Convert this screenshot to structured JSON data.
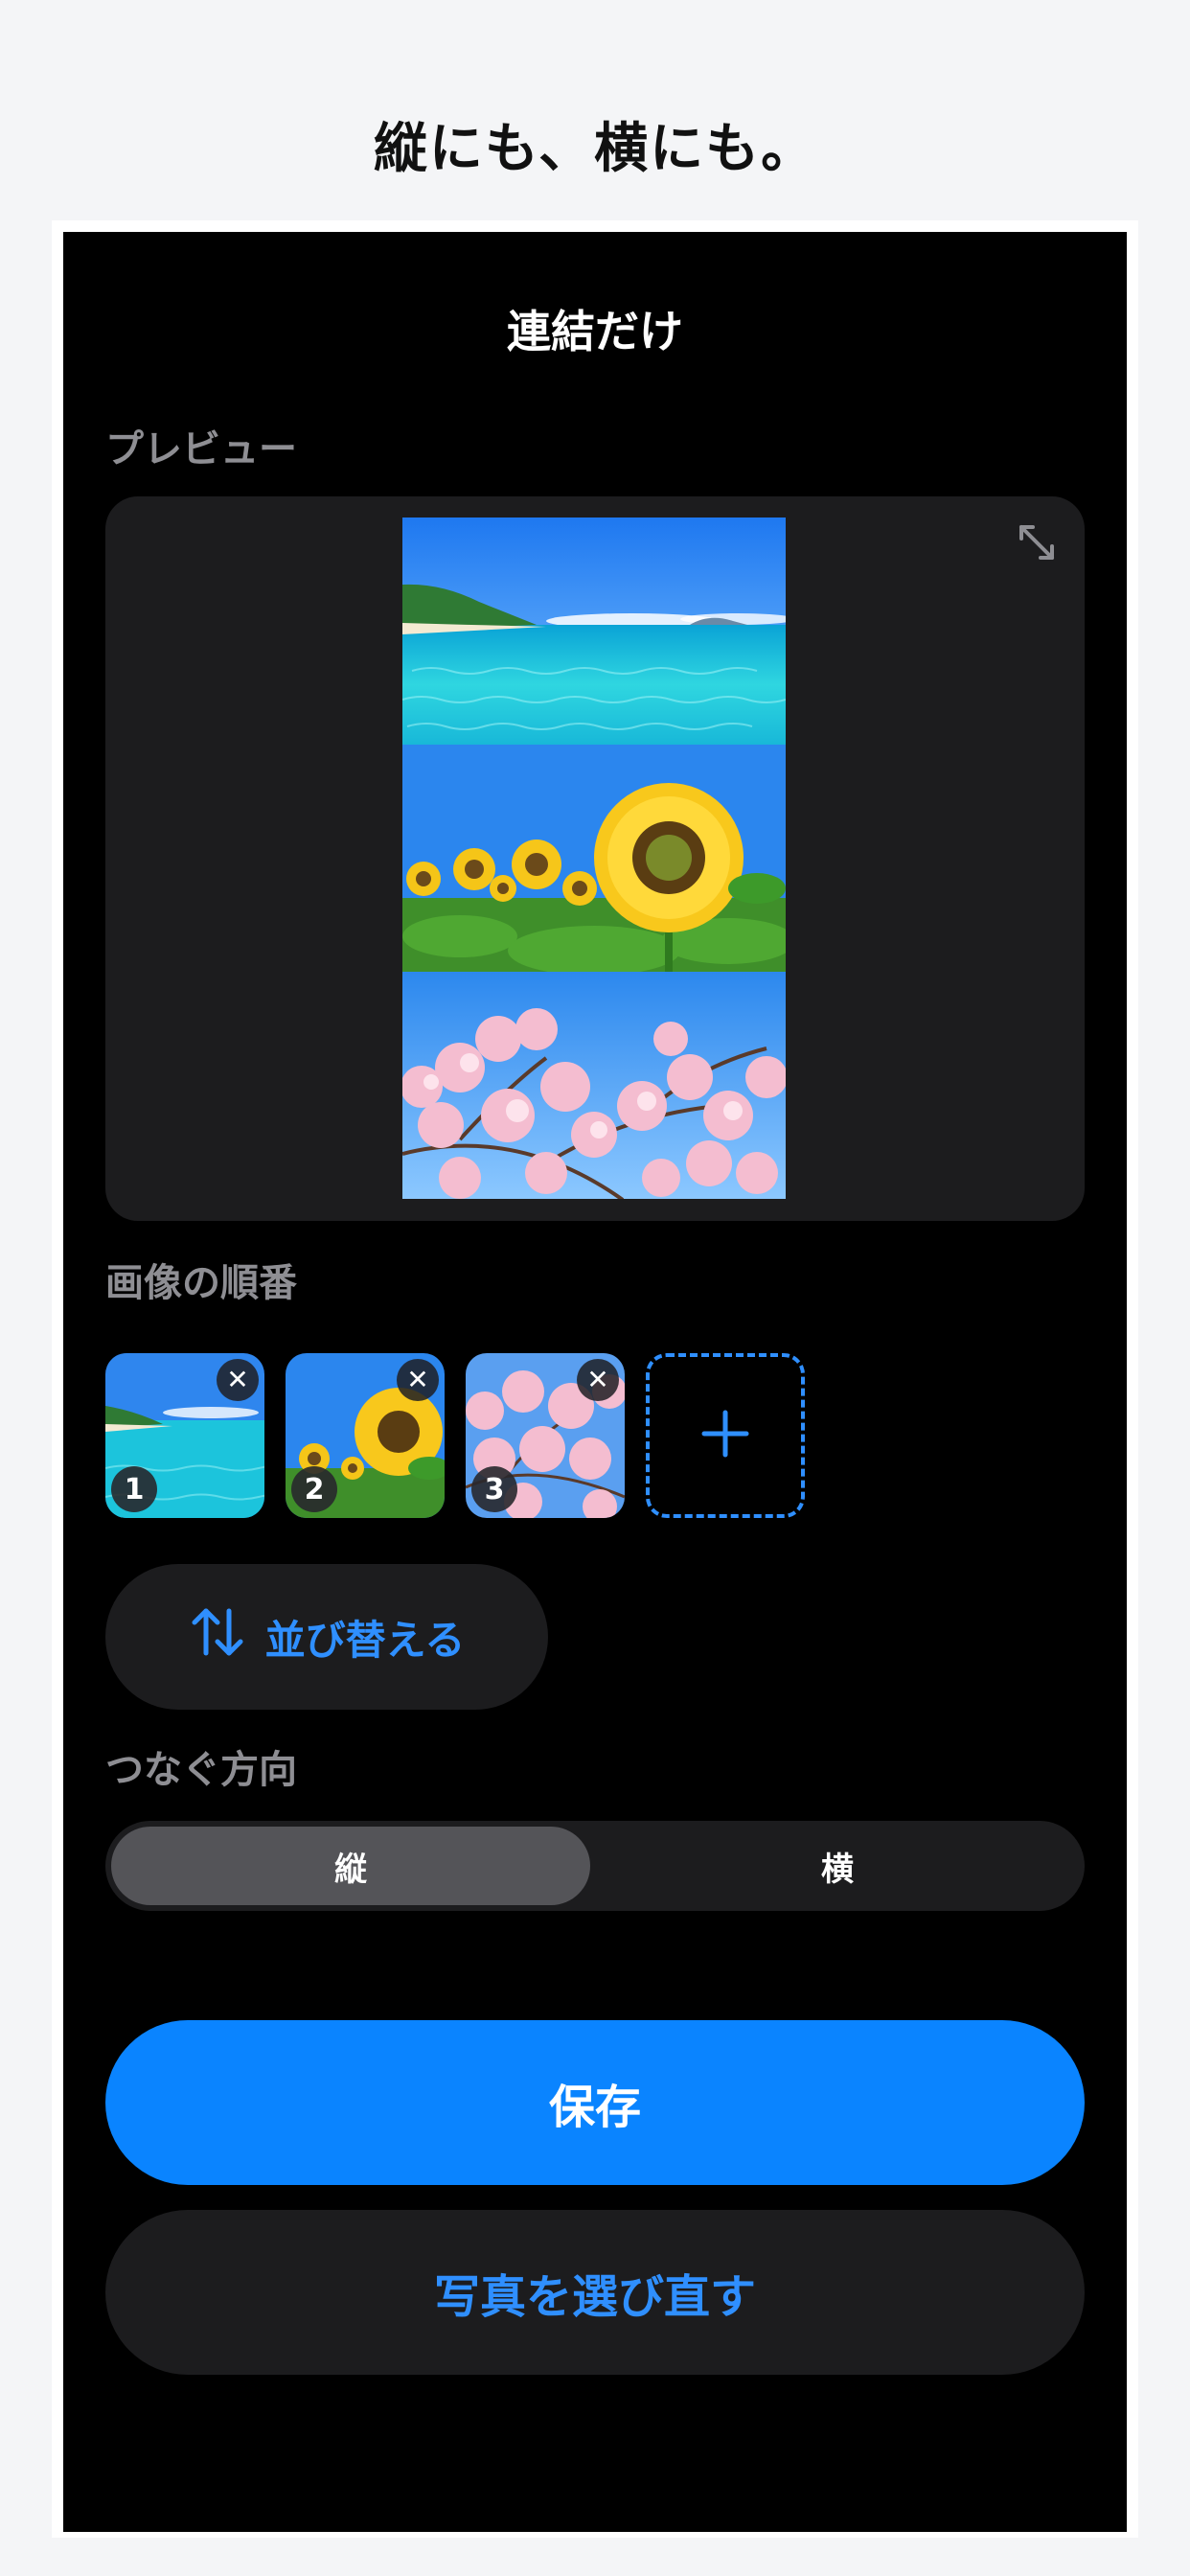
{
  "headline": "縦にも、横にも。",
  "nav": {
    "title": "連結だけ"
  },
  "preview": {
    "label": "プレビュー",
    "expand_icon": "expand-arrows-icon",
    "images": [
      "beach",
      "sunflowers",
      "cherry-blossoms"
    ]
  },
  "order": {
    "label": "画像の順番",
    "thumbnails": [
      {
        "number": "1",
        "image": "beach",
        "remove_icon": "close-icon"
      },
      {
        "number": "2",
        "image": "sunflowers",
        "remove_icon": "close-icon"
      },
      {
        "number": "3",
        "image": "cherry-blossoms",
        "remove_icon": "close-icon"
      }
    ],
    "add_icon": "plus-icon",
    "reorder_label": "並び替える",
    "reorder_icon": "swap-vertical-icon"
  },
  "direction": {
    "label": "つなぐ方向",
    "options": [
      "縦",
      "横"
    ],
    "selected": "縦"
  },
  "actions": {
    "save_label": "保存",
    "reselect_label": "写真を選び直す"
  },
  "colors": {
    "accent": "#0a84ff",
    "link_blue": "#2f8fff",
    "card": "#1c1c1e",
    "segment_active": "#545458"
  }
}
